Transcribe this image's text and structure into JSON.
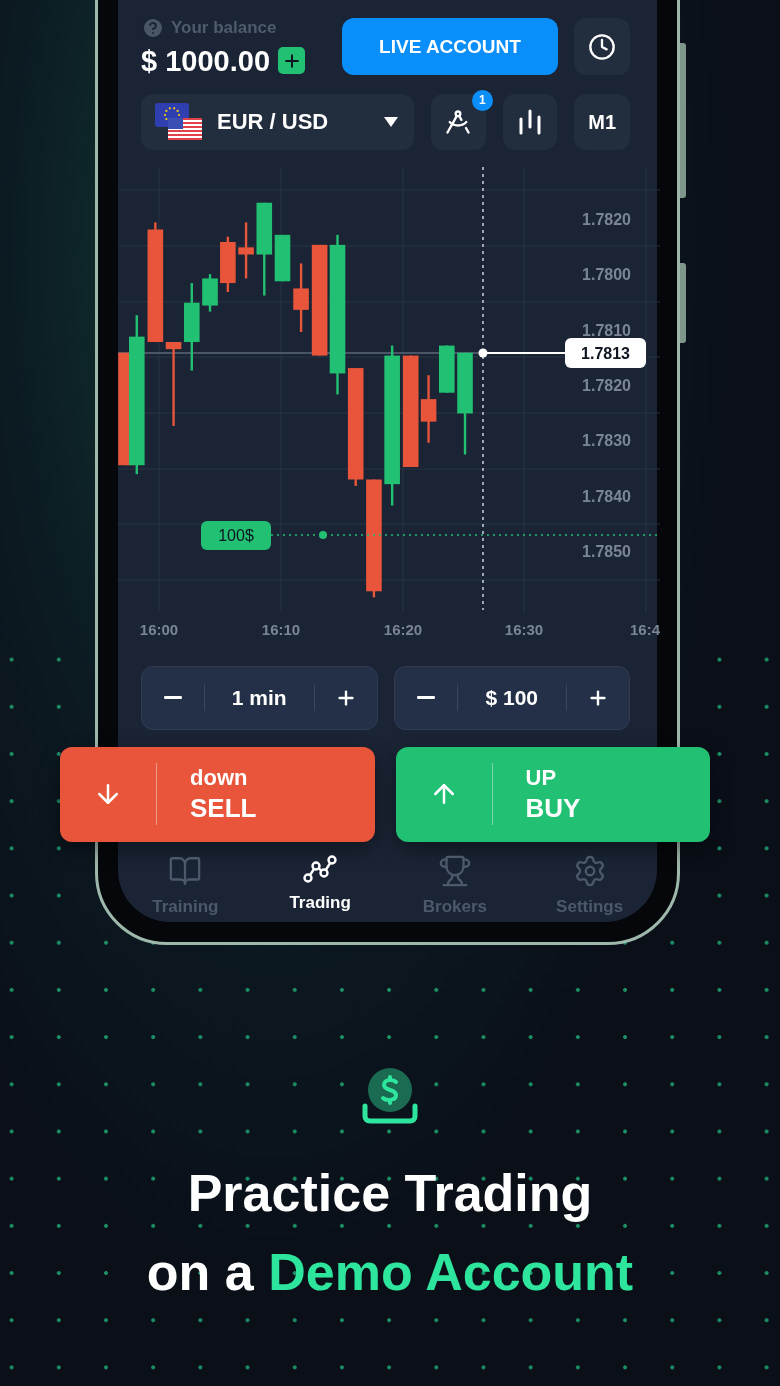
{
  "balance": {
    "label": "Your balance",
    "amount": "$ 1000.00"
  },
  "live_account_button": "LIVE ACCOUNT",
  "pair": "EUR / USD",
  "drawing_tools_badge": "1",
  "timeframe": "M1",
  "chart": {
    "price_labels": [
      "1.7820",
      "1.7800",
      "1.7810",
      "1.7820",
      "1.7830",
      "1.7840",
      "1.7850"
    ],
    "time_labels": [
      "16:00",
      "16:10",
      "16:20",
      "16:30",
      "16:4"
    ],
    "current_price": "1.7813",
    "order_tag": "100$"
  },
  "steppers": [
    {
      "value": "1 min"
    },
    {
      "value": "$ 100"
    }
  ],
  "actions": [
    {
      "kind": "sell",
      "top": "down",
      "bottom": "SELL"
    },
    {
      "kind": "buy",
      "top": "UP",
      "bottom": "BUY"
    }
  ],
  "tabs": [
    {
      "label": "Training",
      "selected": false
    },
    {
      "label": "Trading",
      "selected": true
    },
    {
      "label": "Brokers",
      "selected": false
    },
    {
      "label": "Settings",
      "selected": false
    }
  ],
  "headline": {
    "line1": "Practice Trading",
    "line2": "on a **Demo Account**"
  }
}
